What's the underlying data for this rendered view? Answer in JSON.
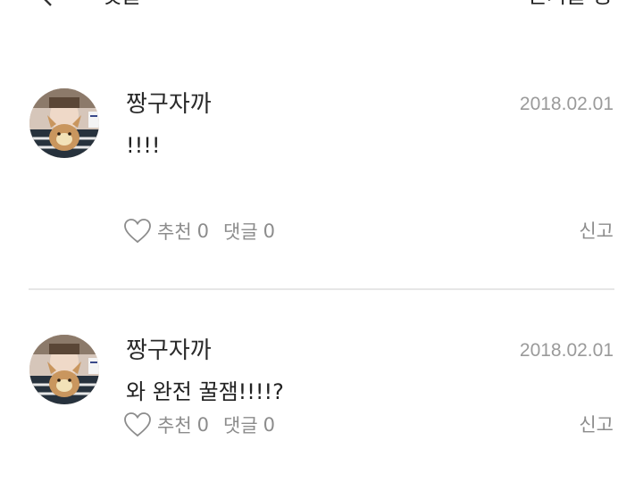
{
  "header": {
    "title": "댓글",
    "action_label": "인기글 등"
  },
  "comments": [
    {
      "author": "짱구자까",
      "date": "2018.02.01",
      "text": "!!!!",
      "like_label": "추천",
      "like_count": "0",
      "reply_label": "댓글",
      "reply_count": "0",
      "report_label": "신고"
    },
    {
      "author": "짱구자까",
      "date": "2018.02.01",
      "text": "와 완전 꿀잼!!!!?",
      "like_label": "추천",
      "like_count": "0",
      "reply_label": "댓글",
      "reply_count": "0",
      "report_label": "신고"
    }
  ],
  "icons": {
    "back": "back-arrow-icon",
    "like": "heart-icon"
  }
}
